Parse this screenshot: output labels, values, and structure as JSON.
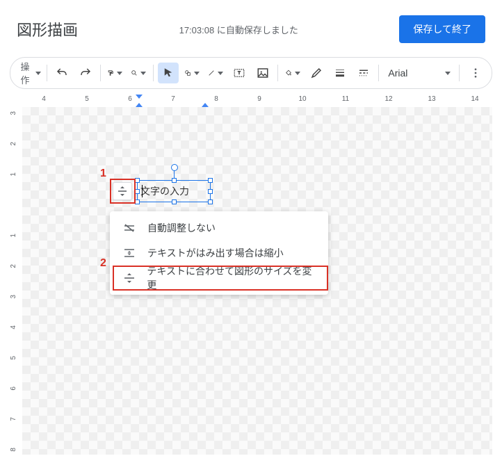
{
  "header": {
    "title": "図形描画",
    "autosave_prefix": "17:03:08 ",
    "autosave_suffix": "に自動保存しました",
    "save_button": "保存して終了"
  },
  "toolbar": {
    "action_label": "操作",
    "font_name": "Arial"
  },
  "ruler": {
    "h_labels": [
      "4",
      "5",
      "6",
      "7",
      "8",
      "9",
      "10",
      "11",
      "12",
      "13",
      "14"
    ],
    "v_labels": [
      "3",
      "2",
      "1",
      "",
      "1",
      "2",
      "3",
      "4",
      "5",
      "6",
      "7",
      "8"
    ]
  },
  "shape": {
    "text": "文字の入力"
  },
  "annotations": {
    "m1": "1",
    "m2": "2"
  },
  "menu": {
    "items": [
      {
        "icon": "no-autofit-icon",
        "label": "自動調整しない"
      },
      {
        "icon": "shrink-overflow-icon",
        "label": "テキストがはみ出す場合は縮小"
      },
      {
        "icon": "resize-to-text-icon",
        "label": "テキストに合わせて図形のサイズを変更"
      }
    ]
  }
}
